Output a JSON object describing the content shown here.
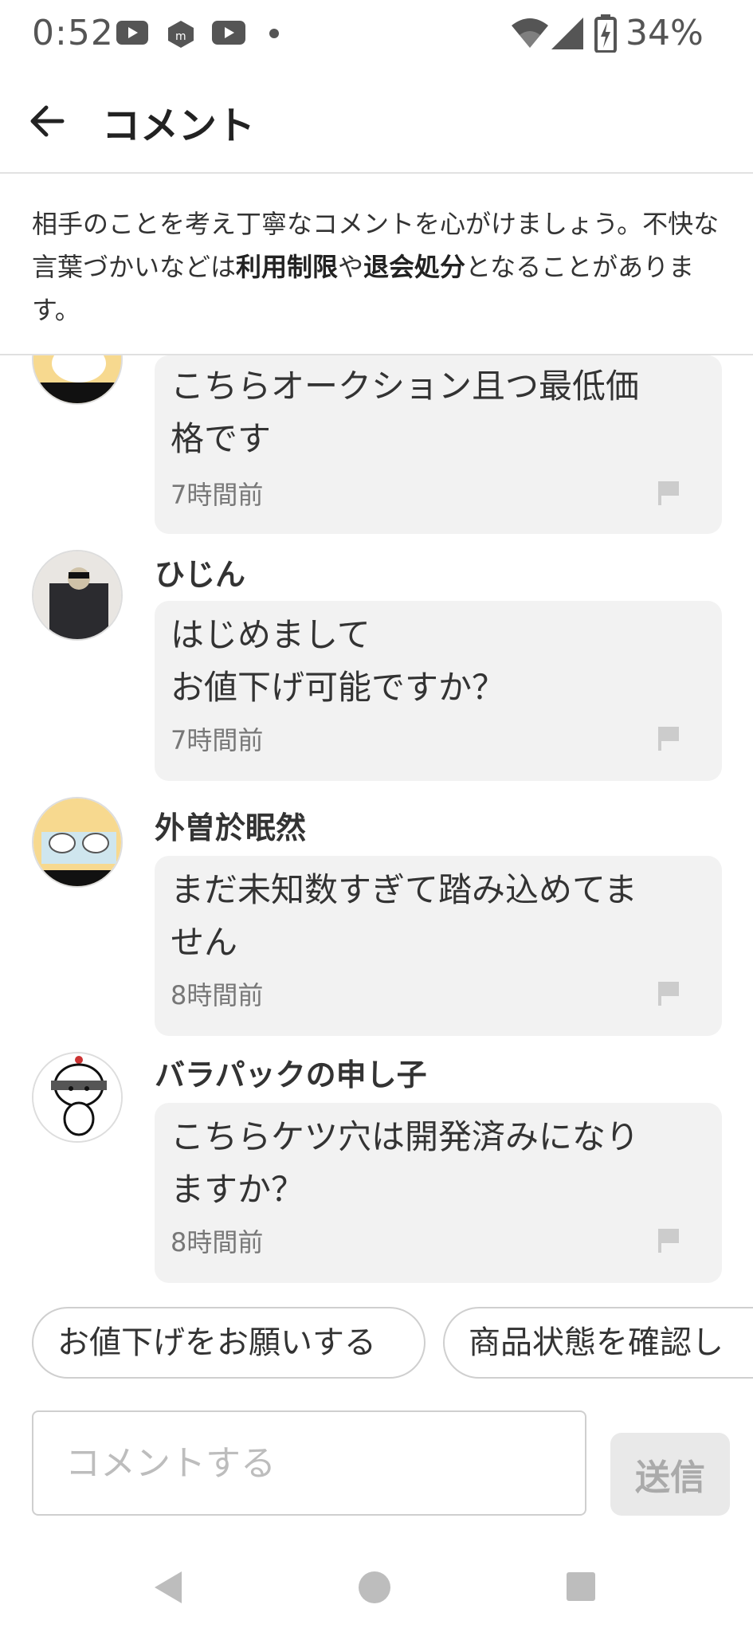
{
  "status_bar": {
    "time": "0:52",
    "battery": "34%"
  },
  "header": {
    "title": "コメント"
  },
  "notice": {
    "text_1": "相手のことを考え丁寧なコメントを心がけましょう。不快な言葉づかいなどは",
    "bold_1": "利用制限",
    "text_2": "や",
    "bold_2": "退会処分",
    "text_3": "となることがあります。"
  },
  "comments": [
    {
      "username": "",
      "text": "こちらオークション且つ最低価\n格です",
      "time": "7時間前"
    },
    {
      "username": "ひじん",
      "text": "はじめまして\nお値下げ可能ですか？",
      "time": "7時間前"
    },
    {
      "username": "外曽於眠然",
      "text": "まだ未知数すぎて踏み込めてま\nせん",
      "time": "8時間前"
    },
    {
      "username": "バラパックの申し子",
      "text": "こちらケツ穴は開発済みになり\nますか？",
      "time": "8時間前"
    }
  ],
  "quick_replies": [
    "お値下げをお願いする",
    "商品状態を確認し"
  ],
  "input": {
    "placeholder": "コメントする",
    "send_label": "送信"
  },
  "colors": {
    "bubble_bg": "#f2f2f2",
    "divider": "#e2e2e2",
    "text_muted": "#777777"
  }
}
